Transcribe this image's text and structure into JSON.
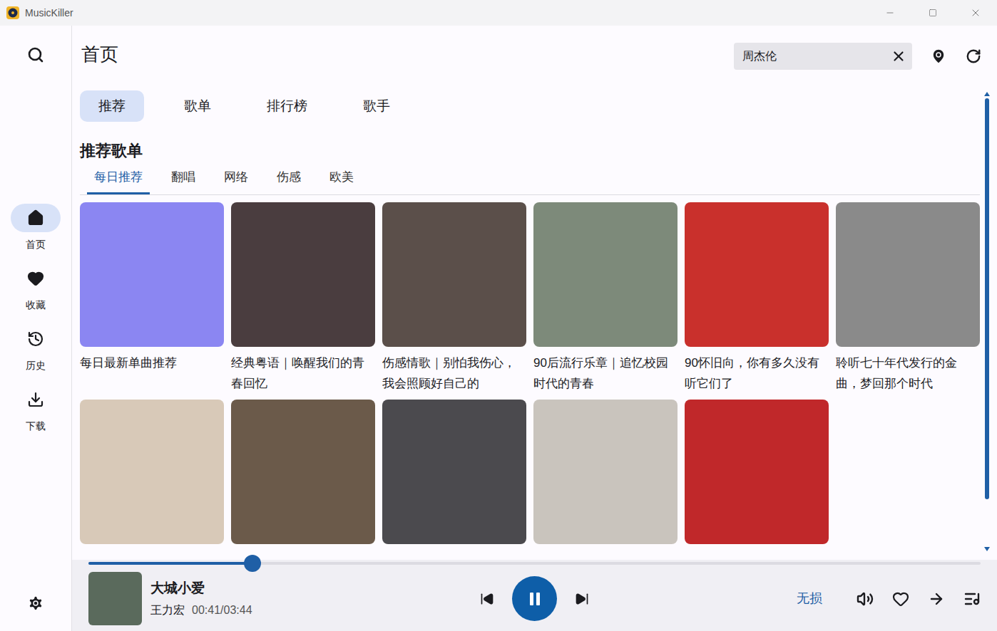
{
  "window": {
    "title": "MusicKiller"
  },
  "sidebar": {
    "items": [
      {
        "label": "首页",
        "selected": true
      },
      {
        "label": "收藏",
        "selected": false
      },
      {
        "label": "历史",
        "selected": false
      },
      {
        "label": "下载",
        "selected": false
      }
    ]
  },
  "header": {
    "title": "首页",
    "search": {
      "value": "周杰伦"
    }
  },
  "tabs": [
    {
      "label": "推荐",
      "selected": true
    },
    {
      "label": "歌单",
      "selected": false
    },
    {
      "label": "排行榜",
      "selected": false
    },
    {
      "label": "歌手",
      "selected": false
    }
  ],
  "section": {
    "title": "推荐歌单",
    "tabs": [
      {
        "label": "每日推荐",
        "selected": true
      },
      {
        "label": "翻唱",
        "selected": false
      },
      {
        "label": "网络",
        "selected": false
      },
      {
        "label": "伤感",
        "selected": false
      },
      {
        "label": "欧美",
        "selected": false
      }
    ]
  },
  "playlists": [
    {
      "title": "每日最新单曲推荐",
      "color": "#8b86f2"
    },
    {
      "title": "经典粤语｜唤醒我们的青春回忆",
      "color": "#4a3d3f"
    },
    {
      "title": "伤感情歌｜别怕我伤心，我会照顾好自己的",
      "color": "#5b4f4a"
    },
    {
      "title": "90后流行乐章｜追忆校园时代的青春",
      "color": "#7d8a7a"
    },
    {
      "title": "90怀旧向，你有多久没有听它们了",
      "color": "#c9302c"
    },
    {
      "title": "聆听七十年代发行的金曲，梦回那个时代",
      "color": "#8a8a8a"
    },
    {
      "title": "",
      "color": "#d8c9b8"
    },
    {
      "title": "",
      "color": "#6b5a4a"
    },
    {
      "title": "",
      "color": "#4b4a4e"
    },
    {
      "title": "",
      "color": "#c9c4bd"
    },
    {
      "title": "",
      "color": "#c0282a"
    }
  ],
  "player": {
    "title": "大城小爱",
    "artist": "王力宏",
    "time": "00:41/03:44",
    "level": 0.184,
    "playing": true,
    "quality": "无损",
    "liked": false,
    "cover_color": "#5a6a5c"
  }
}
